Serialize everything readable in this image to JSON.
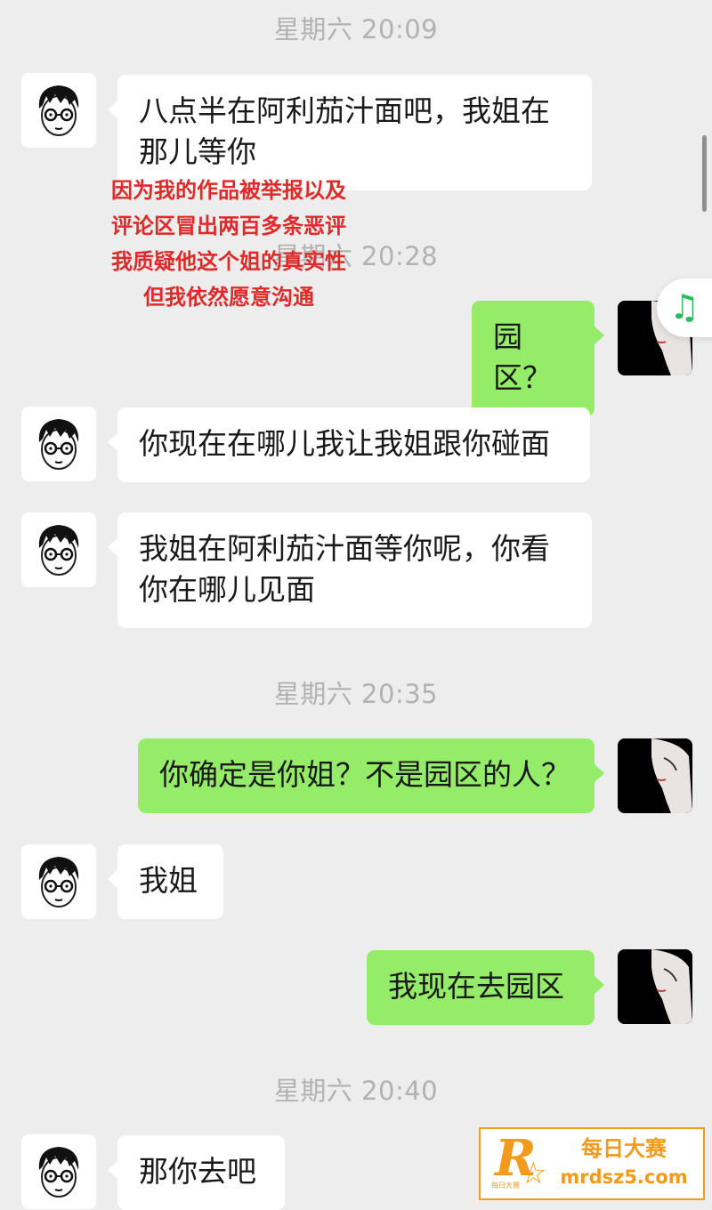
{
  "timestamps": [
    "星期六 20:09",
    "星期六 20:28",
    "星期六 20:35",
    "星期六 20:40"
  ],
  "messages": [
    {
      "from": "friend",
      "text": "八点半在阿利茄汁面吧，我姐在那儿等你"
    },
    {
      "from": "me",
      "text": "园区？"
    },
    {
      "from": "friend",
      "text": "你现在在哪儿我让我姐跟你碰面"
    },
    {
      "from": "friend",
      "text": "我姐在阿利茄汁面等你呢，你看你在哪儿见面"
    },
    {
      "from": "me",
      "text": "你确定是你姐？不是园区的人？"
    },
    {
      "from": "friend",
      "text": "我姐"
    },
    {
      "from": "me",
      "text": "我现在去园区"
    },
    {
      "from": "friend",
      "text": "那你去吧"
    }
  ],
  "overlay_note": "因为我的作品被举报以及评论区冒出两百多条恶评 我质疑他这个姐的真实性 但我依然愿意沟通",
  "icons": {
    "friend_avatar": "cartoon-boy-glasses-avatar",
    "me_avatar": "woman-portrait-avatar",
    "music": "music-note-icon"
  },
  "watermark": {
    "logo_letter": "R",
    "logo_small": "每日大赛",
    "name": "每日大赛",
    "url": "mrdsz5.com"
  },
  "colors": {
    "background": "#ededed",
    "incoming_bubble": "#ffffff",
    "outgoing_bubble": "#95ec69",
    "timestamp": "#b2b2b2",
    "overlay_text": "#e02a2a",
    "watermark": "#f29b1b"
  }
}
